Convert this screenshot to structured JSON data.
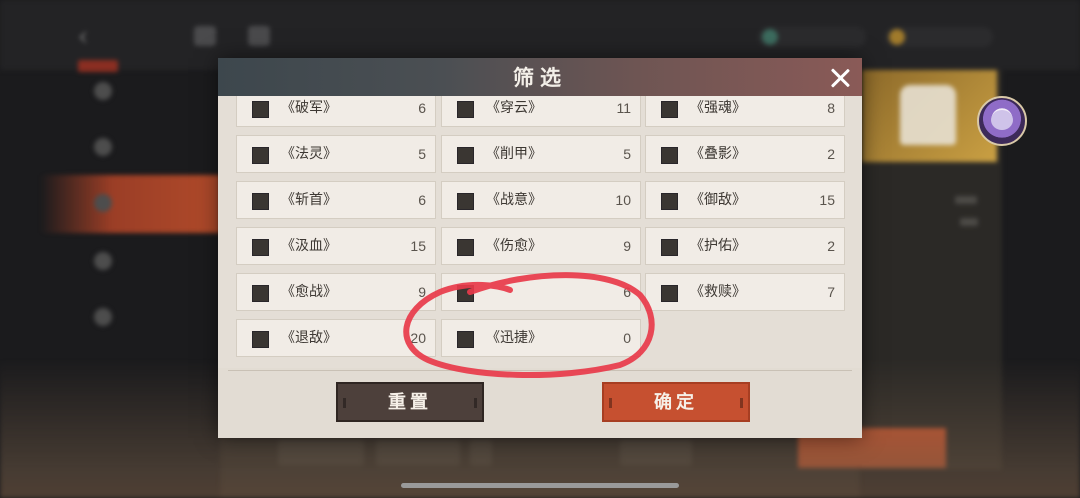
{
  "modal": {
    "title": "筛选",
    "reset_label": "重置",
    "confirm_label": "确定"
  },
  "filters": [
    {
      "name": "《破军》",
      "count": "6"
    },
    {
      "name": "《穿云》",
      "count": "11"
    },
    {
      "name": "《强魂》",
      "count": "8"
    },
    {
      "name": "《法灵》",
      "count": "5"
    },
    {
      "name": "《削甲》",
      "count": "5"
    },
    {
      "name": "《叠影》",
      "count": "2"
    },
    {
      "name": "《斩首》",
      "count": "6"
    },
    {
      "name": "《战意》",
      "count": "10"
    },
    {
      "name": "《御敌》",
      "count": "15"
    },
    {
      "name": "《汲血》",
      "count": "15"
    },
    {
      "name": "《伤愈》",
      "count": "9"
    },
    {
      "name": "《护佑》",
      "count": "2"
    },
    {
      "name": "《愈战》",
      "count": "9"
    },
    {
      "name": "",
      "count": "6"
    },
    {
      "name": "《救赎》",
      "count": "7"
    },
    {
      "name": "《退敌》",
      "count": "20"
    },
    {
      "name": "《迅捷》",
      "count": "0"
    }
  ],
  "colors": {
    "confirm": "#c65030",
    "reset": "#4d403b",
    "annotation": "#e8394a"
  }
}
